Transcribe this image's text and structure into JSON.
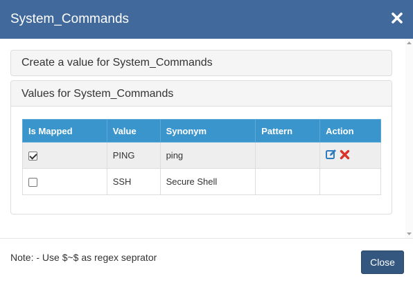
{
  "modal": {
    "title": "System_Commands",
    "close_icon": "close-x-icon"
  },
  "panels": {
    "create_heading": "Create a value for System_Commands",
    "values_heading": "Values for System_Commands"
  },
  "table": {
    "columns": [
      "Is Mapped",
      "Value",
      "Synonym",
      "Pattern",
      "Action"
    ],
    "rows": [
      {
        "mapped": true,
        "value": "PING",
        "synonym": "ping",
        "pattern": "",
        "actions": [
          "edit-icon",
          "delete-icon"
        ]
      },
      {
        "mapped": false,
        "value": "SSH",
        "synonym": "Secure Shell",
        "pattern": "",
        "actions": []
      }
    ]
  },
  "footer": {
    "note": "Note: - Use $~$ as regex seprator",
    "close_label": "Close"
  },
  "colors": {
    "header_bg": "#41699b",
    "table_header_bg": "#3a95cc",
    "edit_icon": "#2e7bbf",
    "delete_icon": "#d9342b",
    "close_button_bg": "#34577f"
  }
}
